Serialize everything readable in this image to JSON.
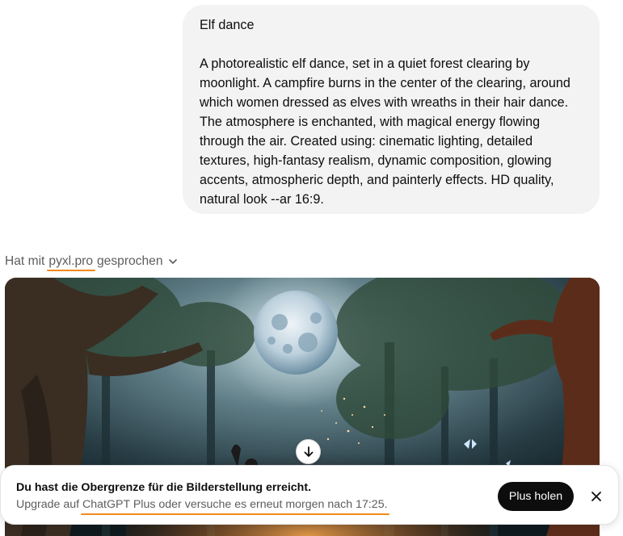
{
  "user_message": {
    "title": "Elf dance",
    "prompt": "A photorealistic elf dance, set in a quiet forest clearing by moonlight. A campfire burns in the center of the clearing, around which women dressed as elves with wreaths in their hair dance. The atmosphere is enchanted, with magical energy flowing through the air. Created using: cinematic lighting, detailed textures, high-fantasy realism, dynamic composition, glowing accents, atmospheric depth, and painterly effects. HD quality, natural look --ar 16:9."
  },
  "tool_header": {
    "prefix": "Hat mit",
    "gpt_name": "pyxl.pro",
    "suffix": "gesprochen",
    "icon": "chevron-down-icon"
  },
  "generated_image": {
    "icon": "generated-image"
  },
  "scroll_button": {
    "icon": "arrow-down-icon"
  },
  "limit_banner": {
    "headline": "Du hast die Obergrenze für die Bilderstellung erreicht.",
    "sub_prefix": "Upgrade auf ",
    "sub_highlight": "ChatGPT Plus oder versuche es erneut morgen nach 17:25.",
    "button_label": "Plus holen",
    "close_icon": "close-icon"
  },
  "colors": {
    "bubble_bg": "#f3f3f3",
    "accent_underline": "#f08a1c",
    "button_bg": "#0d0d0d",
    "muted_text": "#5d5d5d"
  }
}
